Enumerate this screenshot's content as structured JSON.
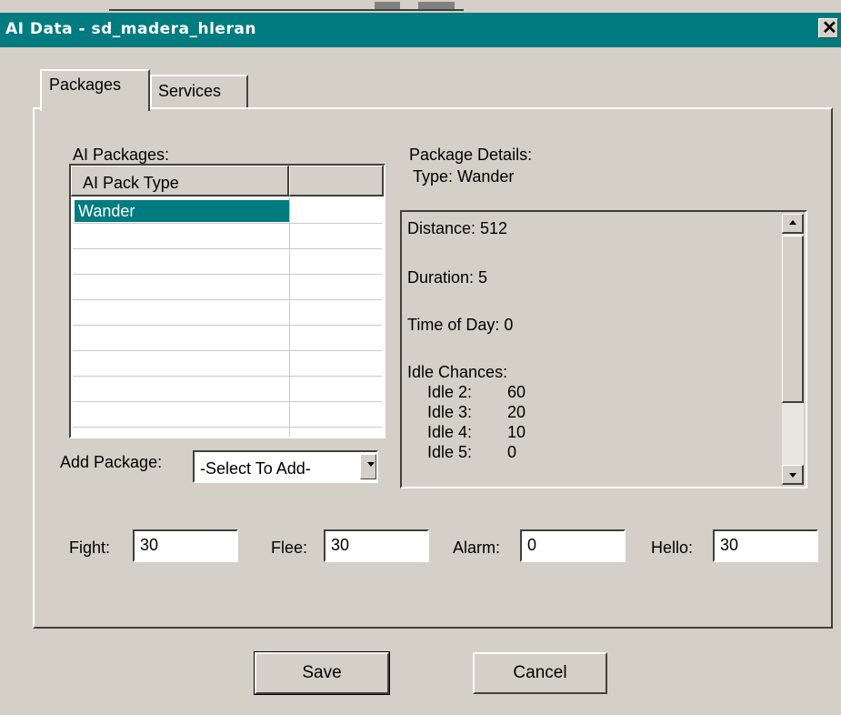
{
  "window": {
    "title": "AI Data - sd_madera_hleran",
    "close_glyph": "✕"
  },
  "tabs": [
    {
      "label": "Packages",
      "active": true
    },
    {
      "label": "Services",
      "active": false
    }
  ],
  "packages": {
    "section_label": "AI Packages:",
    "column_header": "AI Pack Type",
    "rows": [
      "Wander"
    ],
    "add_label": "Add Package:",
    "add_select_value": "-Select To Add-"
  },
  "details": {
    "heading": "Package Details:",
    "type_line": "Type: Wander",
    "distance": "Distance:  512",
    "duration": "Duration:  5",
    "time_of_day": "Time of Day:  0",
    "idle_heading": "Idle Chances:",
    "idle": [
      {
        "label": "Idle 2:",
        "value": "60"
      },
      {
        "label": "Idle 3:",
        "value": "20"
      },
      {
        "label": "Idle 4:",
        "value": "10"
      },
      {
        "label": "Idle 5:",
        "value": "0"
      }
    ]
  },
  "stats": {
    "fight_label": "Fight:",
    "fight_value": "30",
    "flee_label": "Flee:",
    "flee_value": "30",
    "alarm_label": "Alarm:",
    "alarm_value": "0",
    "hello_label": "Hello:",
    "hello_value": "30"
  },
  "buttons": {
    "save": "Save",
    "cancel": "Cancel"
  },
  "colors": {
    "titlebar": "#007b80",
    "face": "#d4d0c8",
    "selection": "#007b80"
  }
}
